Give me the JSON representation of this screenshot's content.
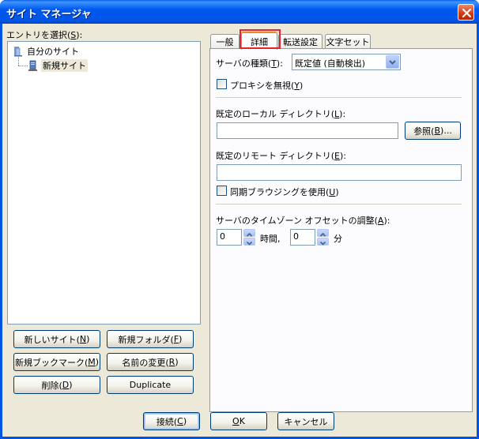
{
  "window": {
    "title": "サイト マネージャ"
  },
  "entries_label": {
    "prefix": "エントリを選択(",
    "key": "S",
    "suffix": "):"
  },
  "tree": {
    "root": "自分のサイト",
    "child": "新規サイト"
  },
  "left_buttons": {
    "new_site": {
      "prefix": "新しいサイト(",
      "key": "N",
      "suffix": ")"
    },
    "new_folder": {
      "prefix": "新規フォルダ(",
      "key": "F",
      "suffix": ")"
    },
    "new_bookmark": {
      "prefix": "新規ブックマーク(",
      "key": "M",
      "suffix": ")"
    },
    "rename": {
      "prefix": "名前の変更(",
      "key": "R",
      "suffix": ")"
    },
    "delete": {
      "prefix": "削除(",
      "key": "D",
      "suffix": ")"
    },
    "duplicate": "Duplicate"
  },
  "tabs": [
    "一般",
    "詳細",
    "転送設定",
    "文字セット"
  ],
  "advanced": {
    "server_type": {
      "prefix": "サーバの種類(",
      "key": "T",
      "suffix": "):",
      "value": "既定値 (自動検出)"
    },
    "bypass_proxy": {
      "prefix": "プロキシを無視(",
      "key": "Y",
      "suffix": ")"
    },
    "local_dir": {
      "prefix": "既定のローカル ディレクトリ(",
      "key": "L",
      "suffix": "):",
      "value": ""
    },
    "browse": {
      "prefix": "参照(",
      "key": "B",
      "suffix": ")..."
    },
    "remote_dir": {
      "prefix": "既定のリモート ディレクトリ(",
      "key": "E",
      "suffix": "):",
      "value": ""
    },
    "sync_browsing": {
      "prefix": "同期ブラウジングを使用(",
      "key": "U",
      "suffix": ")"
    },
    "timezone": {
      "prefix": "サーバのタイムゾーン オフセットの調整(",
      "key": "A",
      "suffix": "):"
    },
    "hours_value": "0",
    "hours_label": "時間,",
    "minutes_value": "0",
    "minutes_label": "分"
  },
  "bottom_buttons": {
    "connect": {
      "prefix": "接続(",
      "key": "C",
      "suffix": ")"
    },
    "ok": {
      "key": "O",
      "suffix": "K"
    },
    "cancel": "キャンセル"
  },
  "colors": {
    "title_bar": "#0054e3",
    "dialog_bg": "#ece9d8",
    "tab_highlight": "#e8242a"
  }
}
